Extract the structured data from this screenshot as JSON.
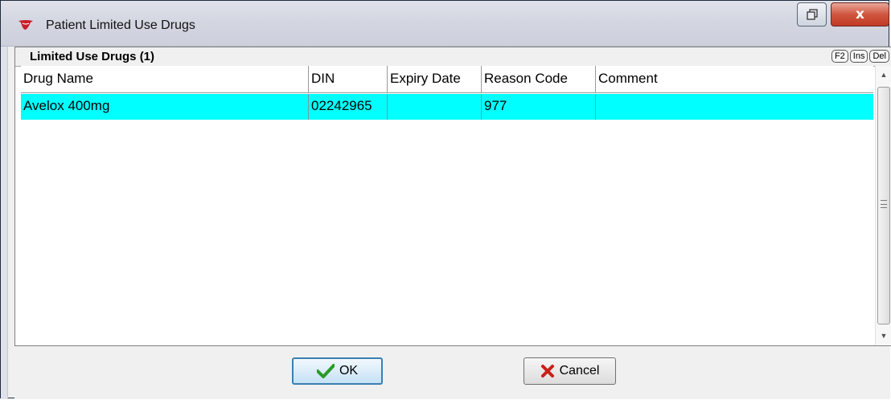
{
  "window": {
    "title": "Patient Limited Use Drugs",
    "close_label": "x"
  },
  "panel": {
    "title": "Limited Use Drugs (1)",
    "hotkeys": [
      "F2",
      "Ins",
      "Del"
    ]
  },
  "table": {
    "columns": [
      "Drug Name",
      "DIN",
      "Expiry Date",
      "Reason Code",
      "Comment"
    ],
    "rows": [
      {
        "drug_name": "Avelox 400mg",
        "din": "02242965",
        "expiry_date": "",
        "reason_code": "977",
        "comment": ""
      }
    ],
    "selected_row_color": "#00ffff"
  },
  "footer": {
    "ok_label": "OK",
    "cancel_label": "Cancel"
  },
  "colors": {
    "ok_icon": "#2a9a2a",
    "cancel_icon": "#c8201a",
    "close_button": "#c74530"
  }
}
